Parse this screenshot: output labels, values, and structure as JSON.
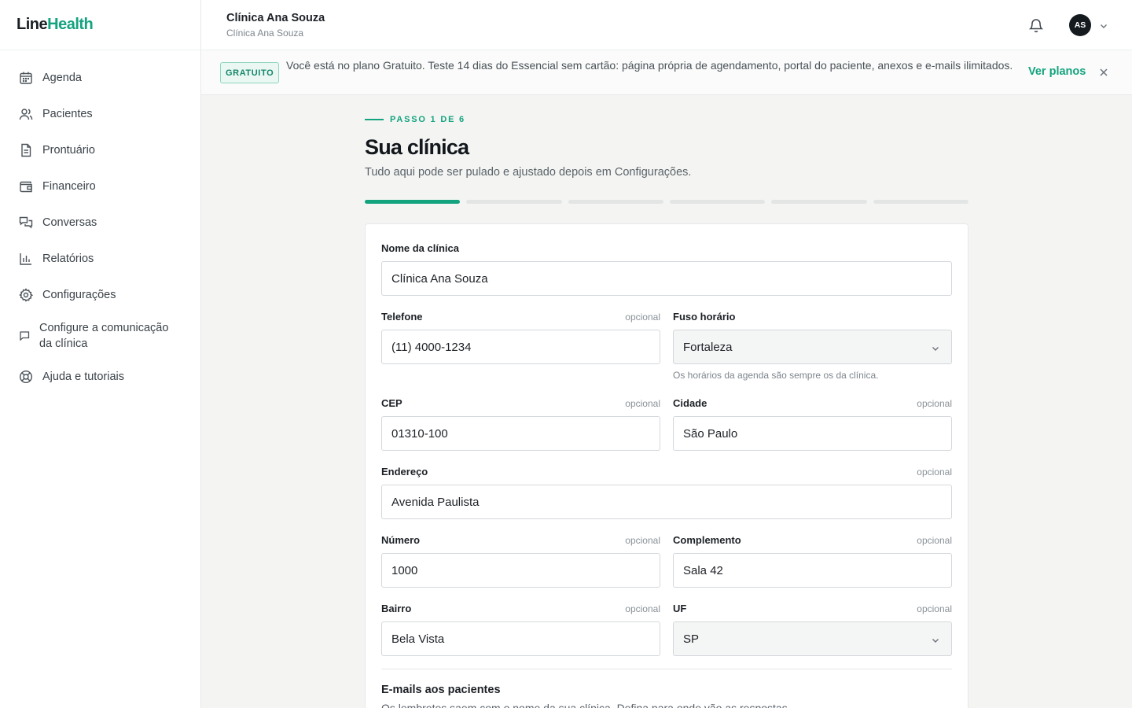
{
  "brand": {
    "part1": "Line",
    "part2": "Health"
  },
  "sidebar": {
    "items": [
      {
        "label": "Agenda",
        "icon": "calendar-icon"
      },
      {
        "label": "Pacientes",
        "icon": "users-icon"
      },
      {
        "label": "Prontuário",
        "icon": "file-text-icon"
      },
      {
        "label": "Financeiro",
        "icon": "wallet-icon"
      },
      {
        "label": "Conversas",
        "icon": "chat-icon"
      },
      {
        "label": "Relatórios",
        "icon": "bar-chart-icon"
      },
      {
        "label": "Configurações",
        "icon": "gear-icon"
      },
      {
        "label": "Configure a comunicação da clínica",
        "icon": "message-square-icon"
      },
      {
        "label": "Ajuda e tutoriais",
        "icon": "life-buoy-icon"
      }
    ]
  },
  "header": {
    "clinic_name": "Clínica Ana Souza",
    "clinic_sub": "Clínica Ana Souza",
    "avatar_initials": "AS"
  },
  "banner": {
    "badge": "GRATUITO",
    "text": "Você está no plano Gratuito. Teste 14 dias do Essencial sem cartão: página própria de agendamento, portal do paciente, anexos e e-mails ilimitados.",
    "link": "Ver planos"
  },
  "wizard": {
    "step": "PASSO 1 DE 6",
    "title": "Sua clínica",
    "subtitle": "Tudo aqui pode ser pulado e ajustado depois em Configurações.",
    "progress": {
      "current": 1,
      "total": 6
    }
  },
  "form": {
    "optional_label": "opcional",
    "clinic_name": {
      "label": "Nome da clínica",
      "value": "Clínica Ana Souza"
    },
    "phone": {
      "label": "Telefone",
      "value": "(11) 4000-1234"
    },
    "timezone": {
      "label": "Fuso horário",
      "value": "Fortaleza",
      "hint": "Os horários da agenda são sempre os da clínica."
    },
    "cep": {
      "label": "CEP",
      "value": "01310-100"
    },
    "city": {
      "label": "Cidade",
      "value": "São Paulo"
    },
    "address": {
      "label": "Endereço",
      "value": "Avenida Paulista"
    },
    "number": {
      "label": "Número",
      "value": "1000"
    },
    "complement": {
      "label": "Complemento",
      "value": "Sala 42"
    },
    "district": {
      "label": "Bairro",
      "value": "Bela Vista"
    },
    "state": {
      "label": "UF",
      "value": "SP"
    },
    "emails_section": {
      "title": "E-mails aos pacientes",
      "subtitle": "Os lembretes saem com o nome da sua clínica. Defina para onde vão as respostas."
    }
  },
  "colors": {
    "accent": "#14a37f",
    "dark": "#151a1f"
  }
}
